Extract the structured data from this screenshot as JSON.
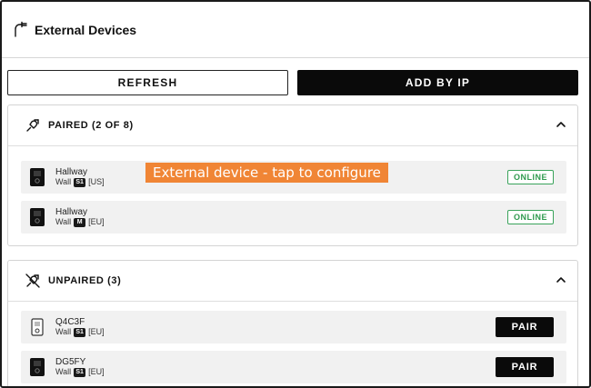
{
  "header": {
    "title": "External Devices",
    "icon": "external-device-icon"
  },
  "actions": {
    "refresh_label": "REFRESH",
    "add_by_ip_label": "ADD BY IP"
  },
  "paired": {
    "title": "PAIRED (2 OF 8)",
    "icon": "plug-icon",
    "devices": [
      {
        "name": "Hallway",
        "location": "Wall",
        "model": "S1",
        "region": "[US]",
        "status": "ONLINE"
      },
      {
        "name": "Hallway",
        "location": "Wall",
        "model": "M",
        "region": "[EU]",
        "status": "ONLINE"
      }
    ]
  },
  "unpaired": {
    "title": "UNPAIRED (3)",
    "icon": "plug-off-icon",
    "devices": [
      {
        "name": "Q4C3F",
        "location": "Wall",
        "model": "S1",
        "region": "[EU]",
        "action": "PAIR"
      },
      {
        "name": "DG5FY",
        "location": "Wall",
        "model": "S1",
        "region": "[EU]",
        "action": "PAIR"
      }
    ]
  },
  "tooltip": {
    "text": "External device - tap to configure"
  },
  "colors": {
    "online": "#2f9a4e",
    "tooltip": "#f08535",
    "primary": "#0a0a0a"
  }
}
